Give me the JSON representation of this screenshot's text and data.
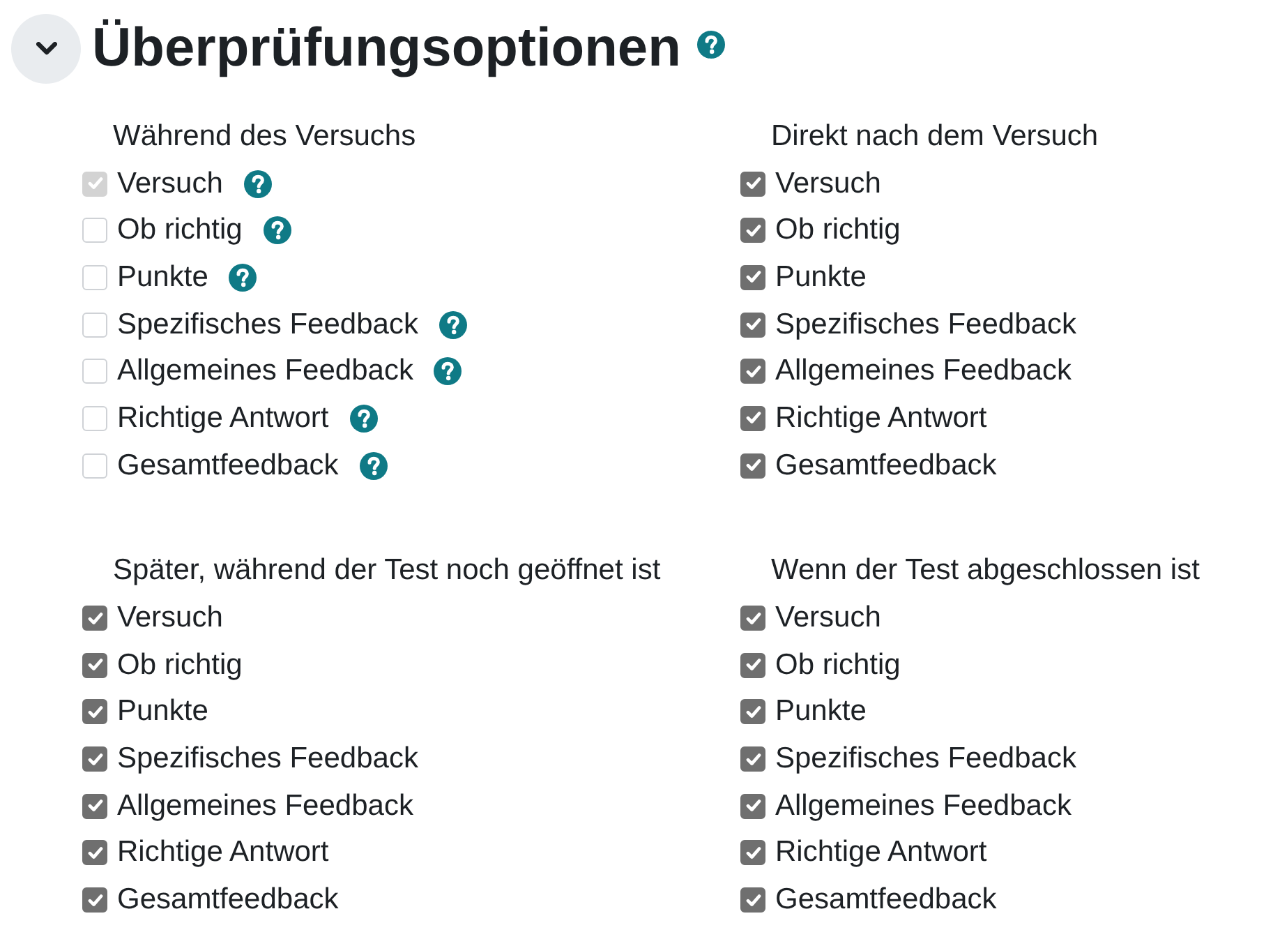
{
  "section": {
    "title": "Überprüfungsoptionen",
    "expanded": true,
    "help": true
  },
  "groups": [
    {
      "heading": "Während des Versuchs",
      "options": [
        {
          "label": "Versuch",
          "checked": true,
          "disabled": true,
          "help": true
        },
        {
          "label": "Ob richtig",
          "checked": false,
          "disabled": false,
          "help": true
        },
        {
          "label": "Punkte",
          "checked": false,
          "disabled": false,
          "help": true
        },
        {
          "label": "Spezifisches Feedback",
          "checked": false,
          "disabled": false,
          "help": true
        },
        {
          "label": "Allgemeines Feedback",
          "checked": false,
          "disabled": false,
          "help": true
        },
        {
          "label": "Richtige Antwort",
          "checked": false,
          "disabled": false,
          "help": true
        },
        {
          "label": "Gesamtfeedback",
          "checked": false,
          "disabled": false,
          "help": true
        }
      ]
    },
    {
      "heading": "Direkt nach dem Versuch",
      "options": [
        {
          "label": "Versuch",
          "checked": true,
          "disabled": false,
          "help": false
        },
        {
          "label": "Ob richtig",
          "checked": true,
          "disabled": false,
          "help": false
        },
        {
          "label": "Punkte",
          "checked": true,
          "disabled": false,
          "help": false
        },
        {
          "label": "Spezifisches Feedback",
          "checked": true,
          "disabled": false,
          "help": false
        },
        {
          "label": "Allgemeines Feedback",
          "checked": true,
          "disabled": false,
          "help": false
        },
        {
          "label": "Richtige Antwort",
          "checked": true,
          "disabled": false,
          "help": false
        },
        {
          "label": "Gesamtfeedback",
          "checked": true,
          "disabled": false,
          "help": false
        }
      ]
    },
    {
      "heading": "Später, während der Test noch geöffnet ist",
      "options": [
        {
          "label": "Versuch",
          "checked": true,
          "disabled": false,
          "help": false
        },
        {
          "label": "Ob richtig",
          "checked": true,
          "disabled": false,
          "help": false
        },
        {
          "label": "Punkte",
          "checked": true,
          "disabled": false,
          "help": false
        },
        {
          "label": "Spezifisches Feedback",
          "checked": true,
          "disabled": false,
          "help": false
        },
        {
          "label": "Allgemeines Feedback",
          "checked": true,
          "disabled": false,
          "help": false
        },
        {
          "label": "Richtige Antwort",
          "checked": true,
          "disabled": false,
          "help": false
        },
        {
          "label": "Gesamtfeedback",
          "checked": true,
          "disabled": false,
          "help": false
        }
      ]
    },
    {
      "heading": "Wenn der Test abgeschlossen ist",
      "options": [
        {
          "label": "Versuch",
          "checked": true,
          "disabled": false,
          "help": false
        },
        {
          "label": "Ob richtig",
          "checked": true,
          "disabled": false,
          "help": false
        },
        {
          "label": "Punkte",
          "checked": true,
          "disabled": false,
          "help": false
        },
        {
          "label": "Spezifisches Feedback",
          "checked": true,
          "disabled": false,
          "help": false
        },
        {
          "label": "Allgemeines Feedback",
          "checked": true,
          "disabled": false,
          "help": false
        },
        {
          "label": "Richtige Antwort",
          "checked": true,
          "disabled": false,
          "help": false
        },
        {
          "label": "Gesamtfeedback",
          "checked": true,
          "disabled": false,
          "help": false
        }
      ]
    }
  ]
}
